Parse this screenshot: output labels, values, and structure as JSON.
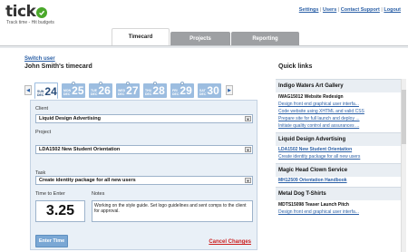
{
  "brand": {
    "name": "tick",
    "tagline": "Track time - Hit budgets",
    "colors": {
      "accent": "#2a5fa6",
      "brand_green": "#4aa82a",
      "day_tab": "#9cbde0",
      "cancel": "#cc1f1f"
    }
  },
  "toplinks": {
    "settings": "Settings",
    "users": "Users",
    "support": "Contact Support",
    "logout": "Logout",
    "sep": "|"
  },
  "tabs": [
    {
      "label": "Timecard",
      "active": true
    },
    {
      "label": "Projects",
      "active": false
    },
    {
      "label": "Reporting",
      "active": false
    }
  ],
  "timecard": {
    "switch_user": "Switch user",
    "title": "John Smith's timecard",
    "prev_icon": "arrow-left-icon",
    "next_icon": "arrow-right-icon",
    "prev_glyph": "◀",
    "next_glyph": "▶",
    "days": [
      {
        "dow": "SUN",
        "mon": "DEC",
        "num": "24",
        "active": true
      },
      {
        "dow": "MON",
        "mon": "DEC",
        "num": "25",
        "active": false
      },
      {
        "dow": "TUE",
        "mon": "DEC",
        "num": "26",
        "active": false
      },
      {
        "dow": "WED",
        "mon": "DEC",
        "num": "27",
        "active": false
      },
      {
        "dow": "THU",
        "mon": "DEC",
        "num": "28",
        "active": false
      },
      {
        "dow": "FRI",
        "mon": "DEC",
        "num": "29",
        "active": false
      },
      {
        "dow": "SAT",
        "mon": "DEC",
        "num": "30",
        "active": false
      }
    ]
  },
  "form": {
    "client_label": "Client",
    "client_value": "Liquid Design Advertising",
    "project_label": "Project",
    "project_value": "LDA1502 New Student Orientation",
    "task_label": "Task",
    "task_value": "Create identity package for all new users",
    "time_label": "Time to Enter",
    "time_value": "3.25",
    "notes_label": "Notes",
    "notes_value": "Working on the style guide. Set logo guidelines and sent comps to the client for approval.",
    "enter_button": "Enter Time",
    "cancel_link": "Cancel Changes",
    "caret_glyph": "▼"
  },
  "quicklinks": {
    "title": "Quick links",
    "groups": [
      {
        "client": "Indigo Waters Art Gallery",
        "project": "IWAG15012 Website Redesign",
        "tasks": [
          "Design front end graphical user interfa...",
          "Code website using XHTML and valid CSS",
          "Prepare site for full launch and deploy ...",
          "Initiate quality control and assurances ..."
        ]
      },
      {
        "client": "Liquid Design Advertising",
        "project": "LDA1502 New Student Orientation",
        "tasks": [
          "Create identity package for all new users"
        ]
      },
      {
        "client": "Magic Head Clown Service",
        "project": "MH12509 Orientation Handbook",
        "tasks": []
      },
      {
        "client": "Metal Dog T-Shirts",
        "project": "MDTS15098 Teaser Launch Pitch",
        "tasks": [
          "Design front end graphical user interfa..."
        ]
      }
    ]
  }
}
